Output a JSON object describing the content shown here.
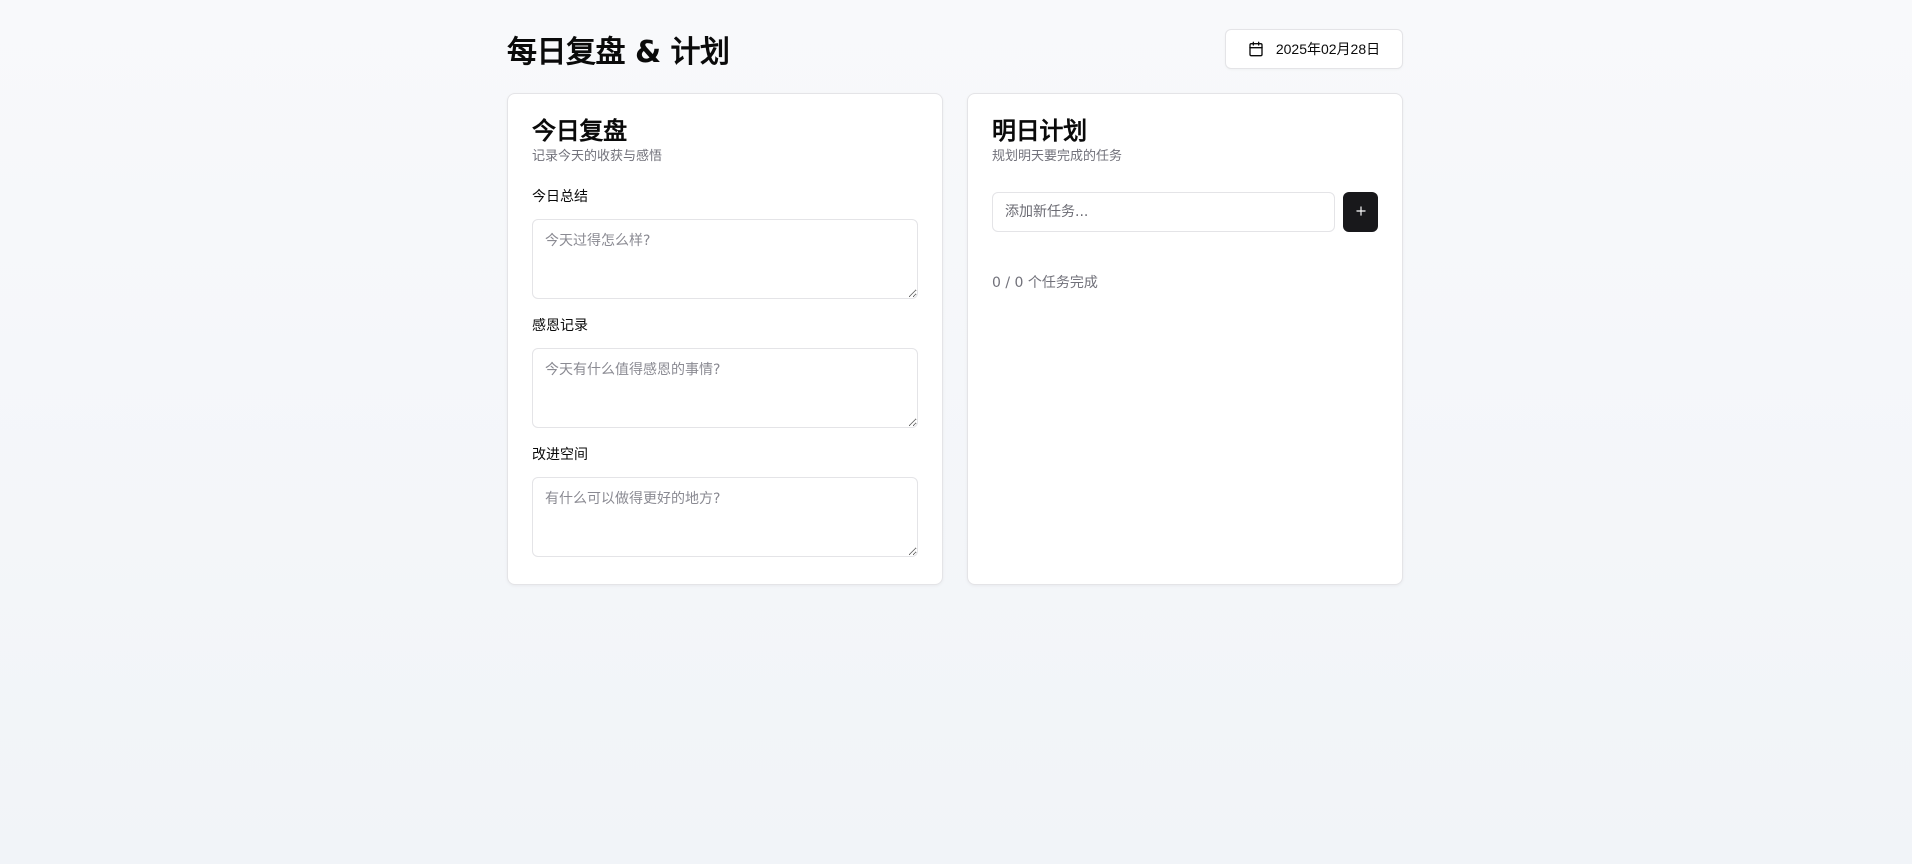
{
  "header": {
    "title": "每日复盘 & 计划",
    "date_icon": "calendar-icon",
    "date": "2025年02月28日"
  },
  "review": {
    "title": "今日复盘",
    "description": "记录今天的收获与感悟",
    "fields": [
      {
        "label": "今日总结",
        "placeholder": "今天过得怎么样?",
        "value": ""
      },
      {
        "label": "感恩记录",
        "placeholder": "今天有什么值得感恩的事情?",
        "value": ""
      },
      {
        "label": "改进空间",
        "placeholder": "有什么可以做得更好的地方?",
        "value": ""
      }
    ]
  },
  "plan": {
    "title": "明日计划",
    "description": "规划明天要完成的任务",
    "input_placeholder": "添加新任务...",
    "input_value": "",
    "add_icon": "plus-icon",
    "completed": 0,
    "total": 0,
    "progress_text": "0 / 0 个任务完成"
  },
  "colors": {
    "primary_button": "#18181b",
    "border": "#e4e4e7",
    "muted_text": "#71717a",
    "card_bg": "#ffffff"
  }
}
